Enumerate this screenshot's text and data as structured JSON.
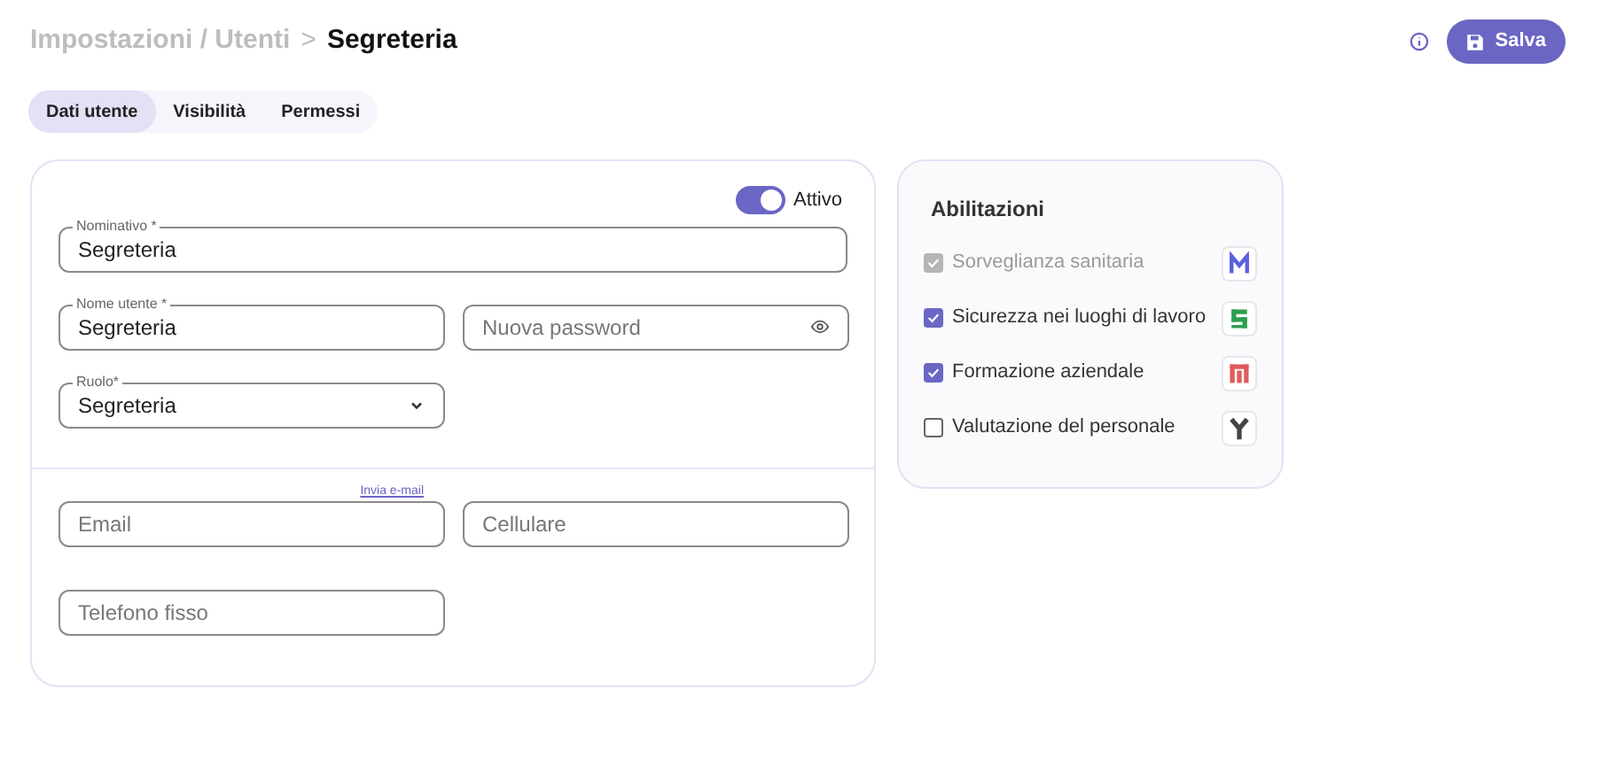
{
  "breadcrumb": {
    "path": "Impostazioni / Utenti",
    "separator": ">",
    "current": "Segreteria"
  },
  "save_button": {
    "label": "Salva"
  },
  "tabs": [
    {
      "label": "Dati utente",
      "selected": true
    },
    {
      "label": "Visibilità",
      "selected": false
    },
    {
      "label": "Permessi",
      "selected": false
    }
  ],
  "user_form": {
    "active_toggle": {
      "label": "Attivo",
      "on": true
    },
    "rows": [
      [
        {
          "kind": "text",
          "label": "Nominativo *",
          "value": "Segreteria"
        }
      ],
      [
        {
          "kind": "text",
          "label": "Nome utente *",
          "value": "Segreteria"
        },
        {
          "kind": "password",
          "placeholder": "Nuova password"
        }
      ],
      [
        {
          "kind": "select",
          "label": "Ruolo*",
          "value": "Segreteria"
        }
      ]
    ],
    "contact_link": "Invia e-mail",
    "contact_rows": [
      [
        {
          "kind": "text",
          "placeholder": "Email"
        },
        {
          "kind": "text",
          "placeholder": "Cellulare"
        }
      ],
      [
        {
          "kind": "text",
          "placeholder": "Telefono fisso"
        }
      ]
    ]
  },
  "permissions": {
    "title": "Abilitazioni",
    "items": [
      {
        "label": "Sorveglianza sanitaria",
        "checked": true,
        "disabled": true,
        "kind": "m",
        "color": "#5b5fe0"
      },
      {
        "label": "Sicurezza nei luoghi di lavoro",
        "checked": true,
        "disabled": false,
        "kind": "s",
        "color": "#2e9e4f"
      },
      {
        "label": "Formazione aziendale",
        "checked": true,
        "disabled": false,
        "kind": "t",
        "color": "#e05a5a"
      },
      {
        "label": "Valutazione del personale",
        "checked": false,
        "disabled": false,
        "kind": "y",
        "color": "#444444"
      }
    ]
  }
}
